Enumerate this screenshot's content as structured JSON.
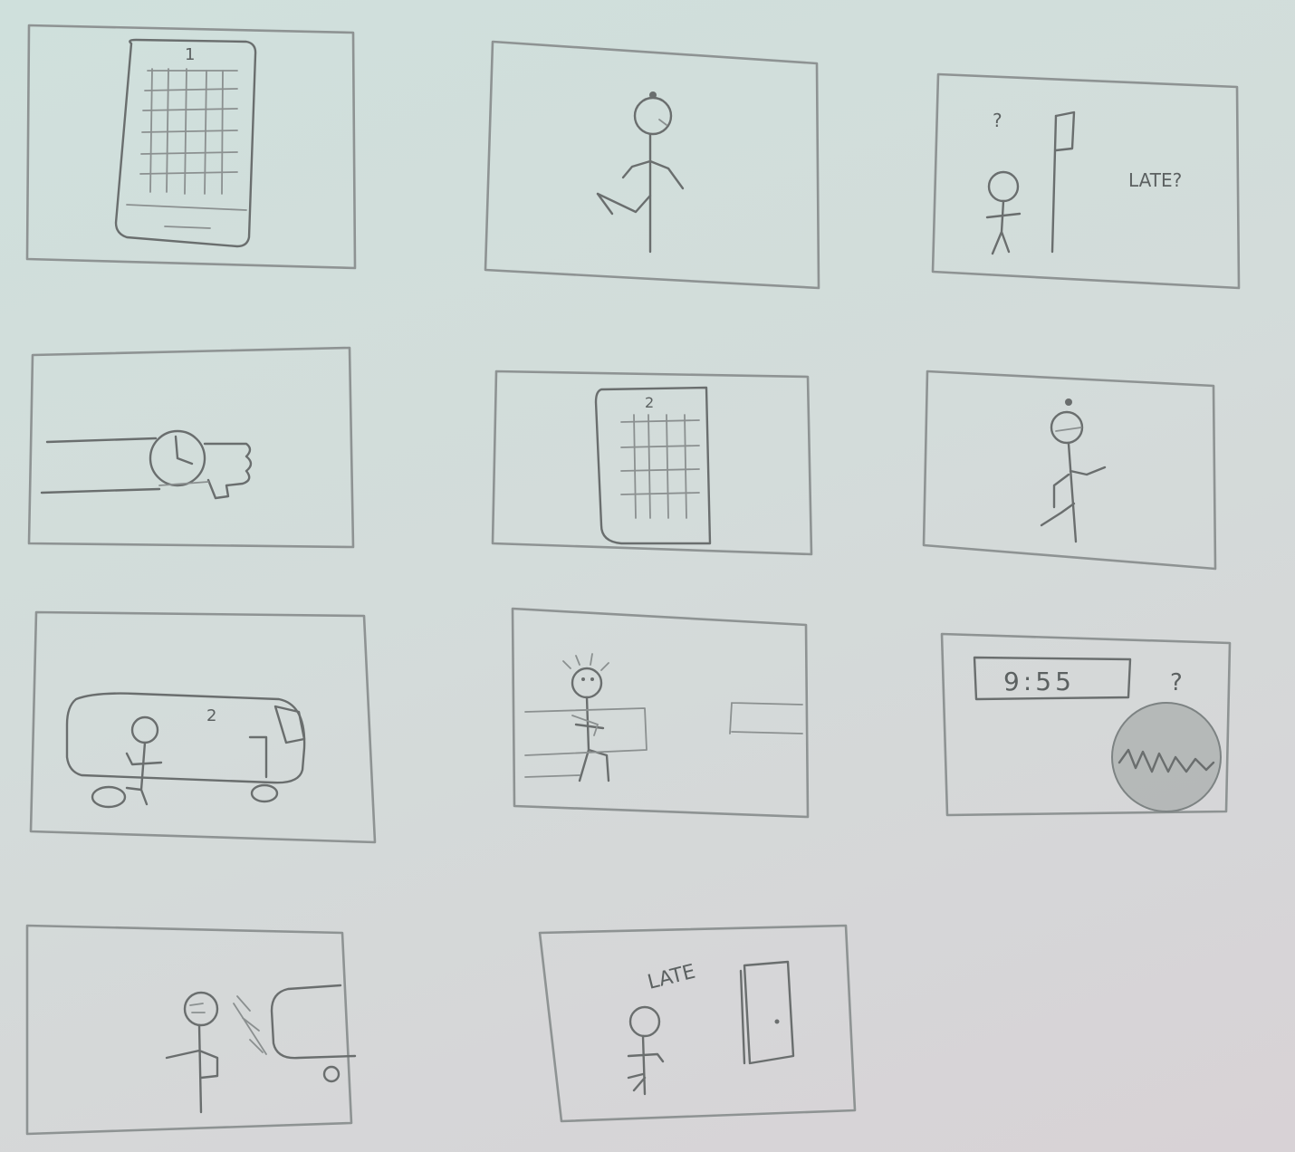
{
  "panels": [
    {
      "id": 1,
      "page_number": "1"
    },
    {
      "id": 2
    },
    {
      "id": 3,
      "question_mark": "?",
      "caption": "LATE?"
    },
    {
      "id": 4
    },
    {
      "id": 5,
      "page_number": "2"
    },
    {
      "id": 6
    },
    {
      "id": 7,
      "bus_number": "2"
    },
    {
      "id": 8
    },
    {
      "id": 9,
      "clock_time": "9:55",
      "question_mark": "?"
    },
    {
      "id": 10
    },
    {
      "id": 11,
      "caption": "LATE"
    }
  ]
}
